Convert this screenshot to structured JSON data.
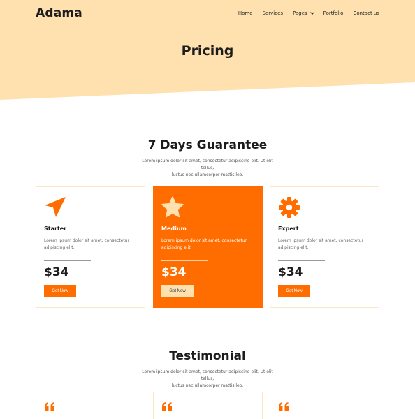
{
  "header": {
    "brand": "Adama",
    "nav": [
      {
        "label": "Home"
      },
      {
        "label": "Services"
      },
      {
        "label": "Pages"
      },
      {
        "label": "Portfolio"
      },
      {
        "label": "Contact us"
      }
    ]
  },
  "hero": {
    "title": "Pricing"
  },
  "guarantee": {
    "title": "7 Days Guarantee",
    "subtitle_line1": "Lorem ipsum dolor sit amet, consectetur adipiscing elit. Ut elit tellus,",
    "subtitle_line2": "luctus nec ullamcorper mattis leo."
  },
  "plans": [
    {
      "name": "Starter",
      "icon": "paper-plane-icon",
      "desc_line1": "Lorem ipsum dolor sit amet, consectetur",
      "desc_line2": "adipiscing elit.",
      "price": "$34",
      "button": "Get Now"
    },
    {
      "name": "Medium",
      "icon": "star-icon",
      "desc_line1": "Lorem ipsum dolor sit amet, consectetur",
      "desc_line2": "adipiscing elit.",
      "price": "$34",
      "button": "Get Now"
    },
    {
      "name": "Expert",
      "icon": "gear-icon",
      "desc_line1": "Lorem ipsum dolor sit amet, consectetur",
      "desc_line2": "adipiscing elit.",
      "price": "$34",
      "button": "Get Now"
    }
  ],
  "testimonial": {
    "title": "Testimonial",
    "subtitle_line1": "Lorem ipsum dolor sit amet, consectetur adipiscing elit. Ut elit tellus,",
    "subtitle_line2": "luctus nec ullamcorper mattis leo.",
    "cards": [
      {
        "icon": "quote-icon"
      },
      {
        "icon": "quote-icon"
      },
      {
        "icon": "quote-icon"
      }
    ]
  },
  "colors": {
    "accent": "#ff6d00",
    "hero_bg": "#ffe1b0",
    "featured_button_bg": "#ffe1b0",
    "icon_light": "#ffe1b0"
  }
}
